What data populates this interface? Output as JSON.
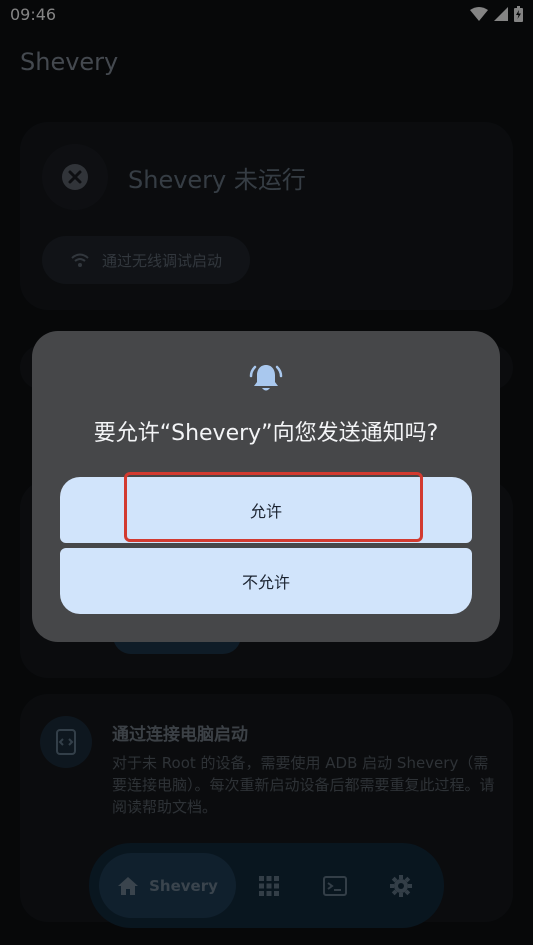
{
  "status_bar": {
    "time": "09:46"
  },
  "app": {
    "title": "Shevery"
  },
  "status_card": {
    "status_text": "Shevery 未运行",
    "wireless_button": "通过无线调试启动"
  },
  "pc_card": {
    "title": "通过连接电脑启动",
    "description": "对于未 Root 的设备，需要使用 ADB 启动 Shevery（需要连接电脑）。每次重新启动设备后都需要重复此过程。请阅读帮助文档。"
  },
  "bottom_nav": {
    "home_label": "Shevery"
  },
  "dialog": {
    "title": "要允许“Shevery”向您发送通知吗?",
    "allow": "允许",
    "deny": "不允许"
  },
  "colors": {
    "accent": "#d1e4fb",
    "highlight": "#d23a30",
    "dialog_bg": "#464749"
  }
}
